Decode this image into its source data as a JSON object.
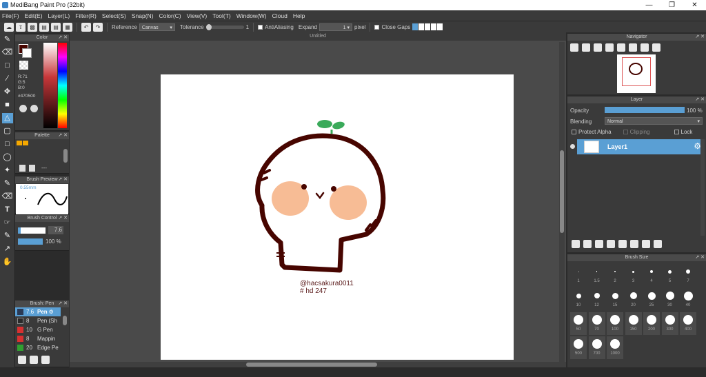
{
  "app": {
    "title": "MediBang Paint Pro (32bit)"
  },
  "menu": [
    "File(F)",
    "Edit(E)",
    "Layer(L)",
    "Filter(R)",
    "Select(S)",
    "Snap(N)",
    "Color(C)",
    "View(V)",
    "Tool(T)",
    "Window(W)",
    "Cloud",
    "Help"
  ],
  "toolbar": {
    "reference_label": "Reference",
    "reference_value": "Canvas",
    "tolerance_label": "Tolerance",
    "tolerance_value": "1",
    "antialias_label": "AntiAliasing",
    "expand_label": "Expand",
    "expand_value": "1",
    "expand_unit": "pixel",
    "close_gaps_label": "Close Gaps"
  },
  "color_panel": {
    "title": "Color",
    "r": "R:71",
    "g": "G:5",
    "b": "B:0",
    "hex": "#470500",
    "fg": "#470500"
  },
  "palette_panel": {
    "title": "Palette",
    "more": "---",
    "swatches": [
      "#f5a800",
      "#f5a800"
    ]
  },
  "brush_preview": {
    "title": "Brush Preview",
    "size": "0.55mm"
  },
  "brush_control": {
    "title": "Brush Control",
    "size": "7.6",
    "opacity": "100 %",
    "opacity_fill": 1.0
  },
  "brush_panel": {
    "title": "Brush: Pen",
    "items": [
      {
        "size": "7.6",
        "name": "Pen",
        "color": "#2a3a55",
        "active": true
      },
      {
        "size": "8",
        "name": "Pen (Sh",
        "color": "#2a2a2a"
      },
      {
        "size": "10",
        "name": "G Pen",
        "color": "#d83030"
      },
      {
        "size": "8",
        "name": "Mappin",
        "color": "#d83030"
      },
      {
        "size": "20",
        "name": "Edge Pe",
        "color": "#30a030"
      }
    ]
  },
  "document": {
    "tab": "Untitled",
    "handle": "@hacsakura0011",
    "code": "# hd 247"
  },
  "navigator": {
    "title": "Navigator"
  },
  "layer_panel": {
    "title": "Layer",
    "opacity_label": "Opacity",
    "opacity_value": "100 %",
    "opacity_fill": 1.0,
    "blending_label": "Blending",
    "blending_value": "Normal",
    "protect_alpha": "Protect Alpha",
    "clipping": "Clipping",
    "lock": "Lock",
    "layer_name": "Layer1"
  },
  "brush_size_panel": {
    "title": "Brush Size",
    "sizes": [
      "1",
      "1.5",
      "2",
      "3",
      "4",
      "5",
      "7",
      "10",
      "12",
      "15",
      "20",
      "25",
      "30",
      "40",
      "50",
      "70",
      "100",
      "150",
      "200",
      "300",
      "400",
      "500",
      "700",
      "1000"
    ]
  },
  "colors": {
    "accent": "#5a9fd4",
    "panel": "#3a3a3a",
    "stroke": "#470500",
    "cheek": "#f7bc95",
    "leaf": "#3aaa5a"
  }
}
